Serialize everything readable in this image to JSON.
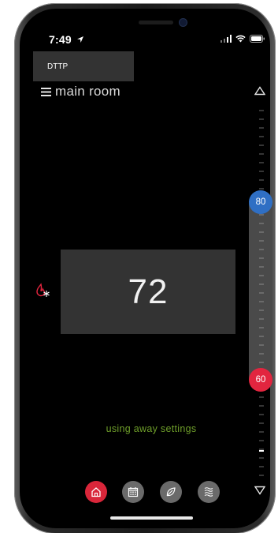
{
  "status_bar": {
    "time": "7:49"
  },
  "header": {
    "device_label": "DTTP",
    "room_name": "main room"
  },
  "setpoints": {
    "cool": "80",
    "heat": "60"
  },
  "thermostat": {
    "current_temp": "72",
    "mode_icon": "heat-cool-icon"
  },
  "status_message": "using away settings",
  "nav": {
    "items": [
      {
        "name": "home",
        "icon": "home-icon",
        "active": true
      },
      {
        "name": "schedule",
        "icon": "calendar-icon",
        "active": false
      },
      {
        "name": "eco",
        "icon": "leaf-icon",
        "active": false
      },
      {
        "name": "fan",
        "icon": "fan-waves-icon",
        "active": false
      }
    ]
  },
  "colors": {
    "cool_setpoint": "#2f6fc4",
    "heat_setpoint": "#e2253f",
    "active_nav": "#d9263a",
    "status_message": "#6f9f2a",
    "panel": "#333333"
  }
}
